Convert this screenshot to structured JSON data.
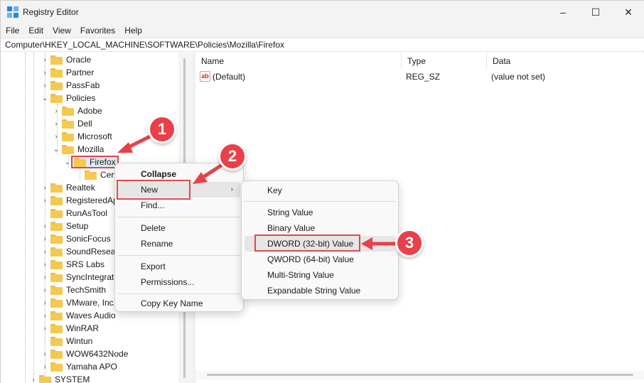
{
  "window": {
    "title": "Registry Editor"
  },
  "controls": {
    "minimize": "–",
    "maximize": "☐",
    "close": "✕"
  },
  "menubar": [
    "File",
    "Edit",
    "View",
    "Favorites",
    "Help"
  ],
  "address": "Computer\\HKEY_LOCAL_MACHINE\\SOFTWARE\\Policies\\Mozilla\\Firefox",
  "tree": [
    {
      "label": "Oracle",
      "expanded": false
    },
    {
      "label": "Partner",
      "expanded": false
    },
    {
      "label": "PassFab",
      "expanded": false
    },
    {
      "label": "Policies",
      "expanded": true
    },
    {
      "label": "Adobe",
      "expanded": false
    },
    {
      "label": "Dell",
      "expanded": false
    },
    {
      "label": "Microsoft",
      "expanded": false
    },
    {
      "label": "Mozilla",
      "expanded": true
    },
    {
      "label": "Firefox",
      "expanded": true,
      "selected": true
    },
    {
      "label": "Cert"
    },
    {
      "label": "Realtek",
      "expanded": false
    },
    {
      "label": "RegisteredAp",
      "expanded": false
    },
    {
      "label": "RunAsTool"
    },
    {
      "label": "Setup",
      "expanded": false
    },
    {
      "label": "SonicFocus",
      "expanded": false
    },
    {
      "label": "SoundResear",
      "expanded": false
    },
    {
      "label": "SRS Labs",
      "expanded": false
    },
    {
      "label": "SyncIntegrati",
      "expanded": false
    },
    {
      "label": "TechSmith",
      "expanded": false
    },
    {
      "label": "VMware, Inc.",
      "expanded": false
    },
    {
      "label": "Waves Audio",
      "expanded": false
    },
    {
      "label": "WinRAR",
      "expanded": false
    },
    {
      "label": "Wintun"
    },
    {
      "label": "WOW6432Node",
      "expanded": false
    },
    {
      "label": "Yamaha APO",
      "expanded": false
    },
    {
      "label": "SYSTEM",
      "expanded": false
    }
  ],
  "list": {
    "columns": [
      "Name",
      "Type",
      "Data"
    ],
    "rows": [
      {
        "name": "(Default)",
        "type": "REG_SZ",
        "data": "(value not set)",
        "icon": "ab"
      }
    ]
  },
  "context_menu": {
    "collapse": "Collapse",
    "new": "New",
    "find": "Find...",
    "delete": "Delete",
    "rename": "Rename",
    "export": "Export",
    "permissions": "Permissions...",
    "copy_key_name": "Copy Key Name"
  },
  "submenu": {
    "key": "Key",
    "string": "String Value",
    "binary": "Binary Value",
    "dword": "DWORD (32-bit) Value",
    "qword": "QWORD (64-bit) Value",
    "multi_string": "Multi-String Value",
    "expandable_string": "Expandable String Value"
  },
  "steps": [
    "1",
    "2",
    "3"
  ],
  "colors": {
    "annotation": "#e94149",
    "folder": "#f5c94d",
    "app_icon": "#1e88e5"
  }
}
